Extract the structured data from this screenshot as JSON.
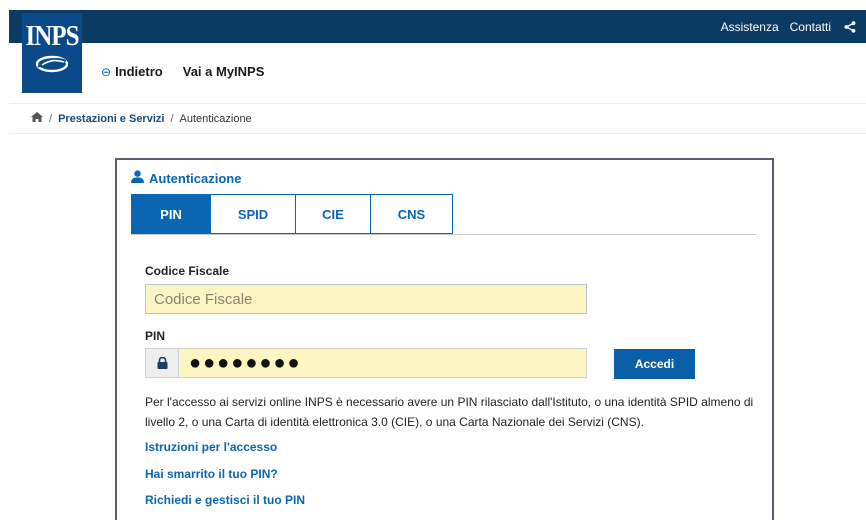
{
  "header": {
    "logo_text": "INPS",
    "top_links": [
      {
        "label": "Assistenza"
      },
      {
        "label": "Contatti"
      }
    ],
    "share_icon": "share-icon",
    "nav": {
      "back_label": "Indietro",
      "myinps_label": "Vai a MyINPS"
    }
  },
  "breadcrumb": {
    "home_icon": "home-icon",
    "items": [
      "Prestazioni e Servizi",
      "Autenticazione"
    ]
  },
  "auth": {
    "title": "Autenticazione",
    "user_icon": "user-icon",
    "tabs": [
      {
        "label": "PIN",
        "active": true
      },
      {
        "label": "SPID"
      },
      {
        "label": "CIE"
      },
      {
        "label": "CNS"
      }
    ],
    "codice_fiscale": {
      "label": "Codice Fiscale",
      "placeholder": "Codice Fiscale",
      "value": ""
    },
    "pin": {
      "label": "PIN",
      "value": "●●●●●●●●",
      "lock_icon": "lock-icon"
    },
    "submit_label": "Accedi",
    "info_text": "Per l'accesso ai servizi online INPS è necessario avere un PIN rilasciato dall'Istituto, o una identità SPID almeno di livello 2, o una Carta di identità elettronica 3.0 (CIE), o una Carta Nazionale dei Servizi (CNS).",
    "links": [
      {
        "label": "Istruzioni per l'accesso"
      },
      {
        "label": "Hai smarrito il tuo PIN?"
      },
      {
        "label": "Richiedi e gestisci il tuo PIN"
      }
    ]
  },
  "colors": {
    "top_bar": "#0b3a63",
    "accent": "#0a66b3",
    "input_bg": "#fdf5c4"
  }
}
